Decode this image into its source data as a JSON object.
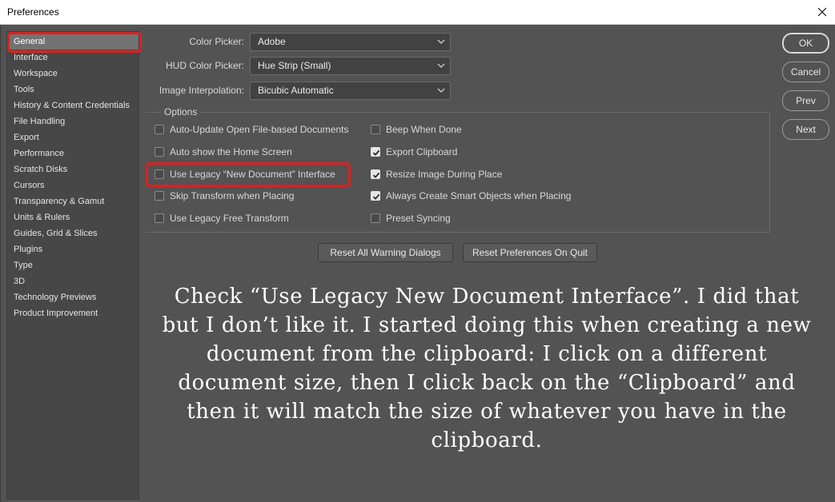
{
  "window": {
    "title": "Preferences",
    "close_icon": "close-icon"
  },
  "nav": {
    "items": [
      {
        "label": "General",
        "selected": true
      },
      {
        "label": "Interface"
      },
      {
        "label": "Workspace"
      },
      {
        "label": "Tools"
      },
      {
        "label": "History & Content Credentials"
      },
      {
        "label": "File Handling"
      },
      {
        "label": "Export"
      },
      {
        "label": "Performance"
      },
      {
        "label": "Scratch Disks"
      },
      {
        "label": "Cursors"
      },
      {
        "label": "Transparency & Gamut"
      },
      {
        "label": "Units & Rulers"
      },
      {
        "label": "Guides, Grid & Slices"
      },
      {
        "label": "Plugins"
      },
      {
        "label": "Type"
      },
      {
        "label": "3D"
      },
      {
        "label": "Technology Previews"
      },
      {
        "label": "Product Improvement"
      }
    ]
  },
  "fields": {
    "color_picker": {
      "label": "Color Picker:",
      "value": "Adobe"
    },
    "hud_color_picker": {
      "label": "HUD Color Picker:",
      "value": "Hue Strip (Small)"
    },
    "image_interpolation": {
      "label": "Image Interpolation:",
      "value": "Bicubic Automatic"
    }
  },
  "options": {
    "legend": "Options",
    "left": [
      {
        "label": "Auto-Update Open File-based Documents",
        "checked": false
      },
      {
        "label": "Auto show the Home Screen",
        "checked": false
      },
      {
        "label": "Use Legacy “New Document” Interface",
        "checked": false
      },
      {
        "label": "Skip Transform when Placing",
        "checked": false
      },
      {
        "label": "Use Legacy Free Transform",
        "checked": false
      }
    ],
    "right": [
      {
        "label": "Beep When Done",
        "checked": false
      },
      {
        "label": "Export Clipboard",
        "checked": true
      },
      {
        "label": "Resize Image During Place",
        "checked": true
      },
      {
        "label": "Always Create Smart Objects when Placing",
        "checked": true
      },
      {
        "label": "Preset Syncing",
        "checked": false
      }
    ]
  },
  "buttons": {
    "reset_warnings": "Reset All Warning Dialogs",
    "reset_prefs": "Reset Preferences On Quit",
    "ok": "OK",
    "cancel": "Cancel",
    "prev": "Prev",
    "next": "Next"
  },
  "caption": "Check “Use Legacy New Document Interface”. I did that but I don’t like it. I started doing this when creating a new document from the clipboard: I click on a different document size, then I click back on the “Clipboard” and then it will match the size of whatever you have in the clipboard.",
  "colors": {
    "highlight": "#e02020",
    "panel": "#535353",
    "nav_bg": "#474747",
    "selected": "#727272"
  }
}
